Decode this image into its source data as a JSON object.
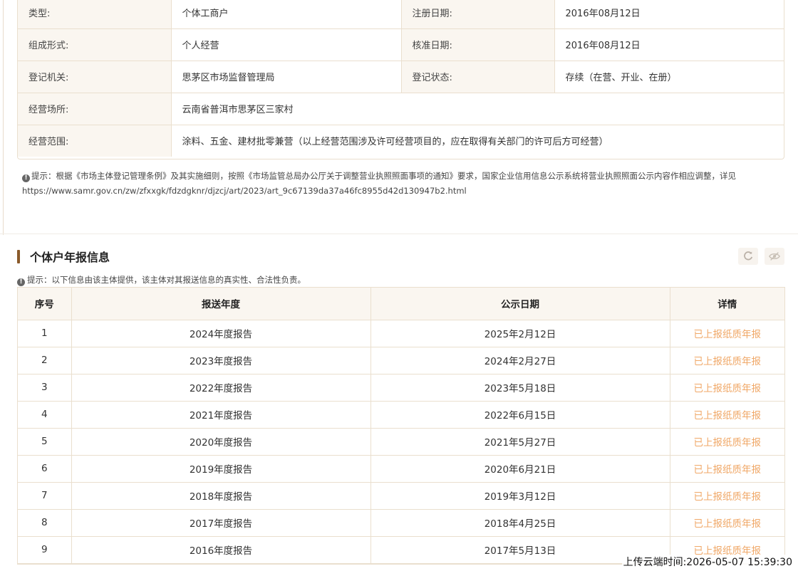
{
  "basic_info": {
    "rows": [
      [
        {
          "label": "类型:",
          "value": "个体工商户"
        },
        {
          "label": "注册日期:",
          "value": "2016年08月12日"
        }
      ],
      [
        {
          "label": "组成形式:",
          "value": "个人经营"
        },
        {
          "label": "核准日期:",
          "value": "2016年08月12日"
        }
      ],
      [
        {
          "label": "登记机关:",
          "value": "思茅区市场监督管理局"
        },
        {
          "label": "登记状态:",
          "value": "存续（在营、开业、在册）"
        }
      ]
    ],
    "address_label": "经营场所:",
    "address_value": "云南省普洱市思茅区三家村",
    "scope_label": "经营范围:",
    "scope_value": "涂料、五金、建材批零兼营（以上经营范围涉及许可经营项目的，应在取得有关部门的许可后方可经营）"
  },
  "notice": {
    "text": "提示：根据《市场主体登记管理条例》及其实施细则，按照《市场监管总局办公厅关于调整营业执照照面事项的通知》要求，国家企业信用信息公示系统将营业执照照面公示内容作相应调整，详见",
    "url": "https://www.samr.gov.cn/zw/zfxxgk/fdzdgknr/djzcj/art/2023/art_9c67139da37a46fc8955d42d130947b2.html"
  },
  "annual_reports": {
    "title": "个体户年报信息",
    "notice": "提示：以下信息由该主体提供，该主体对其报送信息的真实性、合法性负责。",
    "columns": [
      "序号",
      "报送年度",
      "公示日期",
      "详情"
    ],
    "rows": [
      {
        "no": "1",
        "year": "2024年度报告",
        "date": "2025年2月12日",
        "detail": "已上报纸质年报"
      },
      {
        "no": "2",
        "year": "2023年度报告",
        "date": "2024年2月27日",
        "detail": "已上报纸质年报"
      },
      {
        "no": "3",
        "year": "2022年度报告",
        "date": "2023年5月18日",
        "detail": "已上报纸质年报"
      },
      {
        "no": "4",
        "year": "2021年度报告",
        "date": "2022年6月15日",
        "detail": "已上报纸质年报"
      },
      {
        "no": "5",
        "year": "2020年度报告",
        "date": "2021年5月27日",
        "detail": "已上报纸质年报"
      },
      {
        "no": "6",
        "year": "2019年度报告",
        "date": "2020年6月21日",
        "detail": "已上报纸质年报"
      },
      {
        "no": "7",
        "year": "2018年度报告",
        "date": "2019年3月12日",
        "detail": "已上报纸质年报"
      },
      {
        "no": "8",
        "year": "2017年度报告",
        "date": "2018年4月25日",
        "detail": "已上报纸质年报"
      },
      {
        "no": "9",
        "year": "2016年度报告",
        "date": "2017年5月13日",
        "detail": "已上报纸质年报"
      }
    ],
    "icons": [
      "refresh-icon",
      "eye-off-icon"
    ]
  },
  "upload_time": "上传云端时间:2026-05-07 15:39:30",
  "colors": {
    "accent": "#8a5a2b",
    "link": "#f0a868",
    "border": "#eadfce",
    "label_bg": "#faf6f0"
  }
}
